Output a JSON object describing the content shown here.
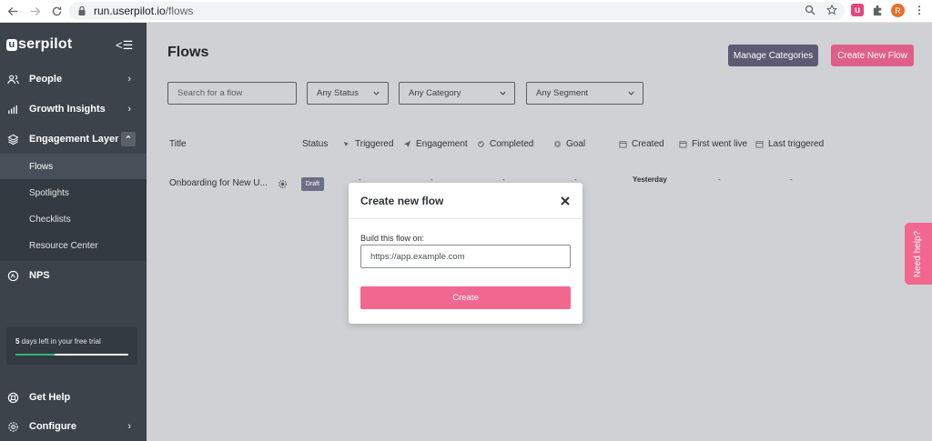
{
  "browser": {
    "url_host": "run.userpilot.io",
    "url_path": "/flows",
    "ext_u_label": "u",
    "avatar_letter": "R",
    "menu_glyph": "⋮"
  },
  "sidebar": {
    "logo_mark": "u",
    "logo_text": "serpilot",
    "collapse_glyph": "<☰",
    "items": [
      {
        "label": "People",
        "icon": "people-icon"
      },
      {
        "label": "Growth Insights",
        "icon": "bar-chart-icon"
      },
      {
        "label": "Engagement Layer",
        "icon": "layers-icon"
      },
      {
        "label": "NPS",
        "icon": "nps-icon"
      },
      {
        "label": "Get Help",
        "icon": "lifebuoy-icon"
      },
      {
        "label": "Configure",
        "icon": "gear-icon"
      }
    ],
    "sub_items": [
      {
        "label": "Flows",
        "active": true
      },
      {
        "label": "Spotlights"
      },
      {
        "label": "Checklists"
      },
      {
        "label": "Resource Center"
      }
    ],
    "trial": {
      "days": "5",
      "text": " days left in your free trial",
      "progress": 0.35
    }
  },
  "main": {
    "title": "Flows",
    "manage_categories_label": "Manage Categories",
    "create_new_flow_label": "Create New Flow",
    "search_placeholder": "Search for a flow",
    "filters": {
      "status": "Any Status",
      "category": "Any Category",
      "segment": "Any Segment"
    },
    "columns": [
      "Title",
      "Status",
      "Triggered",
      "Engagement",
      "Completed",
      "Goal",
      "Created",
      "First went live",
      "Last triggered"
    ],
    "rows": [
      {
        "title": "Onboarding for New U...",
        "status": "Draft",
        "triggered": "-",
        "engagement": "-",
        "completed": "-",
        "goal": "-",
        "created": "Yesterday",
        "first_live": "-",
        "last_triggered": "-"
      }
    ]
  },
  "need_help_label": "Need help?",
  "modal": {
    "title": "Create new flow",
    "label": "Build this flow on:",
    "input_placeholder": "https://app.example.com",
    "create_label": "Create"
  },
  "colors": {
    "sidebar": "#3c434b",
    "accent_pink": "#f2678f",
    "manage_btn": "#5d5a72",
    "progress_green": "#2fb37a"
  }
}
